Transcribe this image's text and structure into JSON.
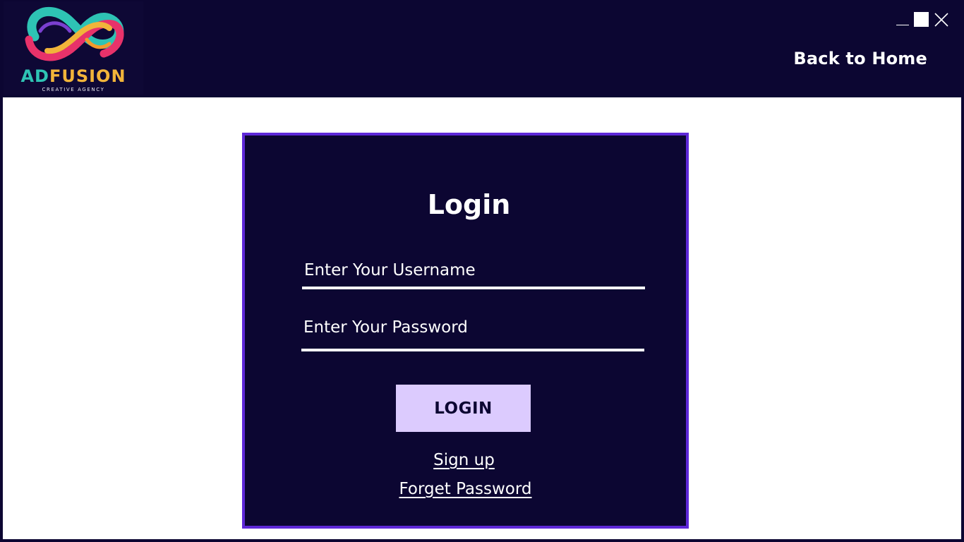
{
  "header": {
    "logo": {
      "brand": "ADFUSION",
      "tagline": "CREATIVE AGENCY"
    },
    "window_controls": [
      "minimize-icon",
      "maximize-icon",
      "close-icon"
    ],
    "back_link": "Back to Home"
  },
  "login_card": {
    "title": "Login",
    "username_placeholder": "Enter Your Username",
    "password_placeholder": "Enter Your Password",
    "button_label": "LOGIN",
    "signup_link": "Sign up",
    "forgot_link": "Forget Password"
  },
  "colors": {
    "background": "#0c0632",
    "card_border": "#5e28d8",
    "button": "#dccbfe",
    "content_area": "#ffffff",
    "logo_teal": "#2ec3b4",
    "logo_gold": "#f1b43a",
    "logo_pink": "#e8326a"
  }
}
